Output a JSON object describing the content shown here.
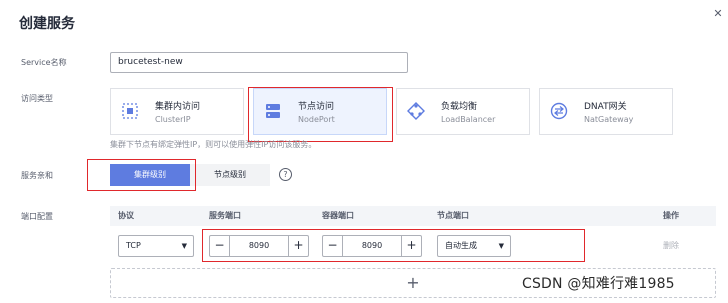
{
  "dialog": {
    "title": "创建服务"
  },
  "service_name": {
    "label": "Service名称",
    "value": "brucetest-new"
  },
  "access_type": {
    "label": "访问类型",
    "options": [
      {
        "name": "集群内访问",
        "sub": "ClusterIP",
        "selected": false,
        "icon": "cluster-icon"
      },
      {
        "name": "节点访问",
        "sub": "NodePort",
        "selected": true,
        "icon": "node-server-icon"
      },
      {
        "name": "负载均衡",
        "sub": "LoadBalancer",
        "selected": false,
        "icon": "load-balancer-icon"
      },
      {
        "name": "DNAT网关",
        "sub": "NatGateway",
        "selected": false,
        "icon": "nat-gateway-icon"
      }
    ],
    "hint": "集群下节点有绑定弹性IP，则可以使用弹性IP访问该服务。"
  },
  "affinity": {
    "label": "服务亲和",
    "options": [
      "集群级别",
      "节点级别"
    ],
    "selected": "集群级别",
    "help": "?"
  },
  "ports": {
    "label": "端口配置",
    "headers": [
      "协议",
      "服务端口",
      "容器端口",
      "节点端口",
      "操作"
    ],
    "rows": [
      {
        "protocol": "TCP",
        "service_port": "8090",
        "container_port": "8090",
        "node_port": "自动生成",
        "action": "删除"
      }
    ],
    "add": "+"
  },
  "watermark": "CSDN @知难行难1985",
  "colors": {
    "primary": "#5e7ce0",
    "highlight": "#e0282c"
  }
}
